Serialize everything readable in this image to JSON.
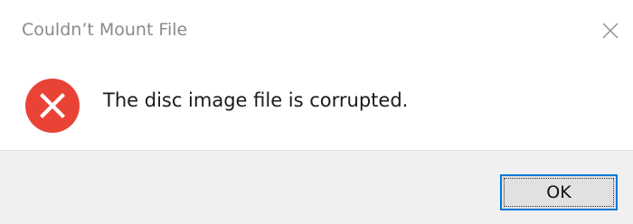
{
  "dialog": {
    "title": "Couldn’t Mount File",
    "message": "The disc image file is corrupted.",
    "ok_label": "OK",
    "icon": "error-icon",
    "close_icon": "close-icon"
  },
  "colors": {
    "error_red": "#e81123",
    "accent": "#0078d7",
    "footer_bg": "#f0f0f0",
    "title_text": "#8a8a8a"
  }
}
